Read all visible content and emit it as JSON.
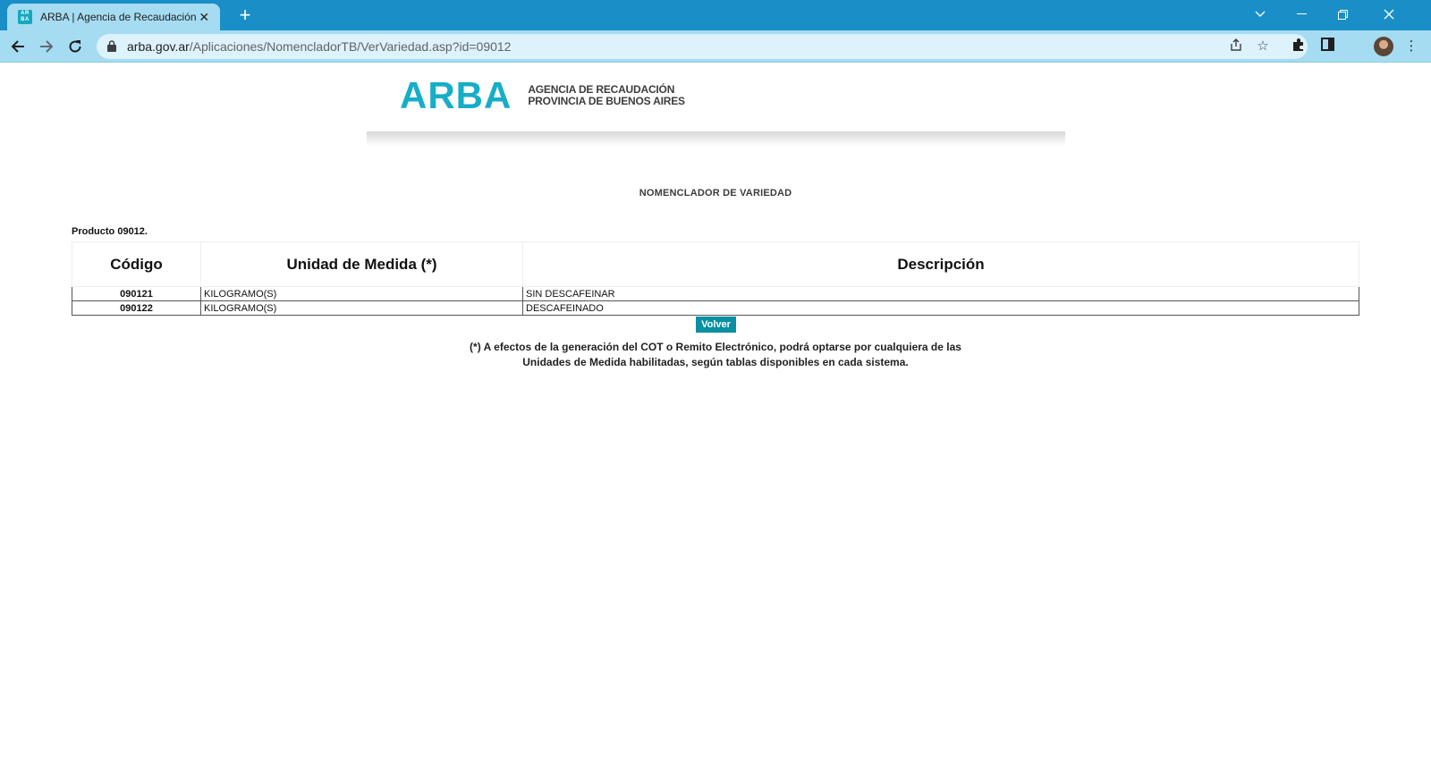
{
  "browser": {
    "tab_title": "ARBA | Agencia de Recaudación de la Provincia de Buenos Aires",
    "favicon_text_top": "AR",
    "favicon_text_bottom": "BA",
    "url_host": "arba.gov.ar",
    "url_path": "/Aplicaciones/NomencladorTB/VerVariedad.asp?id=09012",
    "colors": {
      "tabstrip": "#1a8fc7",
      "toolbar": "#a5dcf2"
    }
  },
  "header": {
    "logo_mark": "ARBA",
    "logo_line1": "AGENCIA DE RECAUDACIÓN",
    "logo_line2": "PROVINCIA DE BUENOS AIRES",
    "brand_color": "#16adc7"
  },
  "main": {
    "heading": "NOMENCLADOR DE VARIEDAD",
    "product_label": "Producto 09012.",
    "table": {
      "headers": [
        "Código",
        "Unidad de Medida (*)",
        "Descripción"
      ],
      "rows": [
        {
          "code": "090121",
          "unit": "KILOGRAMO(S)",
          "description": "SIN DESCAFEINAR"
        },
        {
          "code": "090122",
          "unit": "KILOGRAMO(S)",
          "description": "DESCAFEINADO"
        }
      ]
    },
    "back_button": "Volver",
    "footnote_line1": "(*) A efectos de la generación del COT o Remito Electrónico, podrá optarse por cualquiera de las",
    "footnote_line2": "Unidades de Medida habilitadas, según tablas disponibles en cada sistema."
  }
}
